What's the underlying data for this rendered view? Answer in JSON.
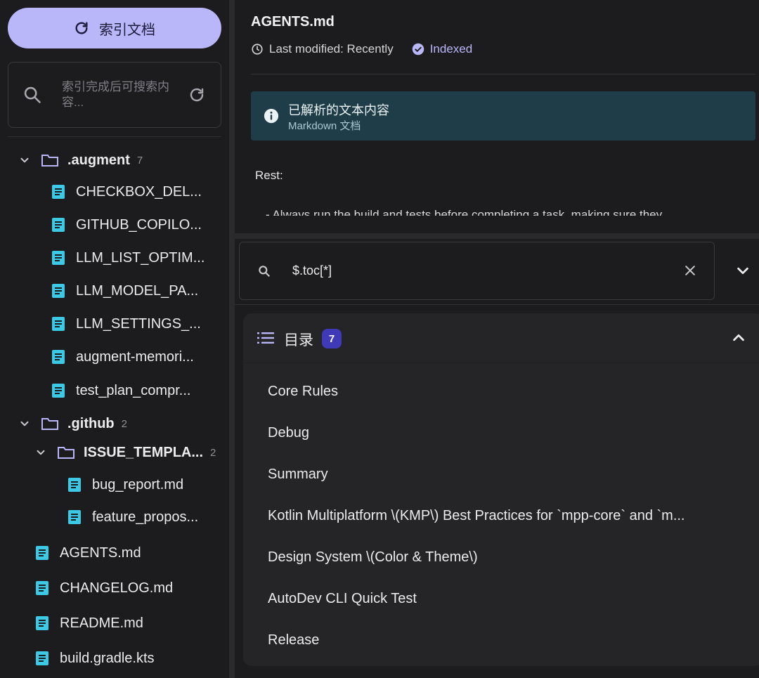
{
  "sidebar": {
    "index_button_label": "索引文档",
    "search_placeholder": "索引完成后可搜索内容...",
    "tree": [
      {
        "label": ".augment",
        "count": "7"
      },
      {
        "label": "CHECKBOX_DEL..."
      },
      {
        "label": "GITHUB_COPILO..."
      },
      {
        "label": "LLM_LIST_OPTIM..."
      },
      {
        "label": "LLM_MODEL_PA..."
      },
      {
        "label": "LLM_SETTINGS_..."
      },
      {
        "label": "augment-memori..."
      },
      {
        "label": "test_plan_compr..."
      },
      {
        "label": ".github",
        "count": "2"
      },
      {
        "label": "ISSUE_TEMPLA...",
        "count": "2"
      },
      {
        "label": "bug_report.md"
      },
      {
        "label": "feature_propos..."
      },
      {
        "label": "AGENTS.md"
      },
      {
        "label": "CHANGELOG.md"
      },
      {
        "label": "README.md"
      },
      {
        "label": "build.gradle.kts"
      }
    ]
  },
  "document": {
    "title": "AGENTS.md",
    "last_modified": "Last modified: Recently",
    "status": "Indexed",
    "info_title": "已解析的文本内容",
    "info_subtitle": "Markdown 文档",
    "body_heading": "Rest:",
    "body_line": "- Always run the build and tests before completing a task, making sure they"
  },
  "query": {
    "value": "$.toc[*]"
  },
  "toc": {
    "label": "目录",
    "count": "7",
    "items": [
      "Core Rules",
      "Debug",
      "Summary",
      "Kotlin Multiplatform \\(KMP\\) Best Practices for `mpp-core` and `m...",
      "Design System \\(Color & Theme\\)",
      "AutoDev CLI Quick Test",
      "Release"
    ]
  },
  "colors": {
    "accent": "#b9b6f9",
    "file_icon": "#3cc9e6",
    "info_bg": "#1f3d48",
    "badge_bg": "#3f3ab8"
  }
}
